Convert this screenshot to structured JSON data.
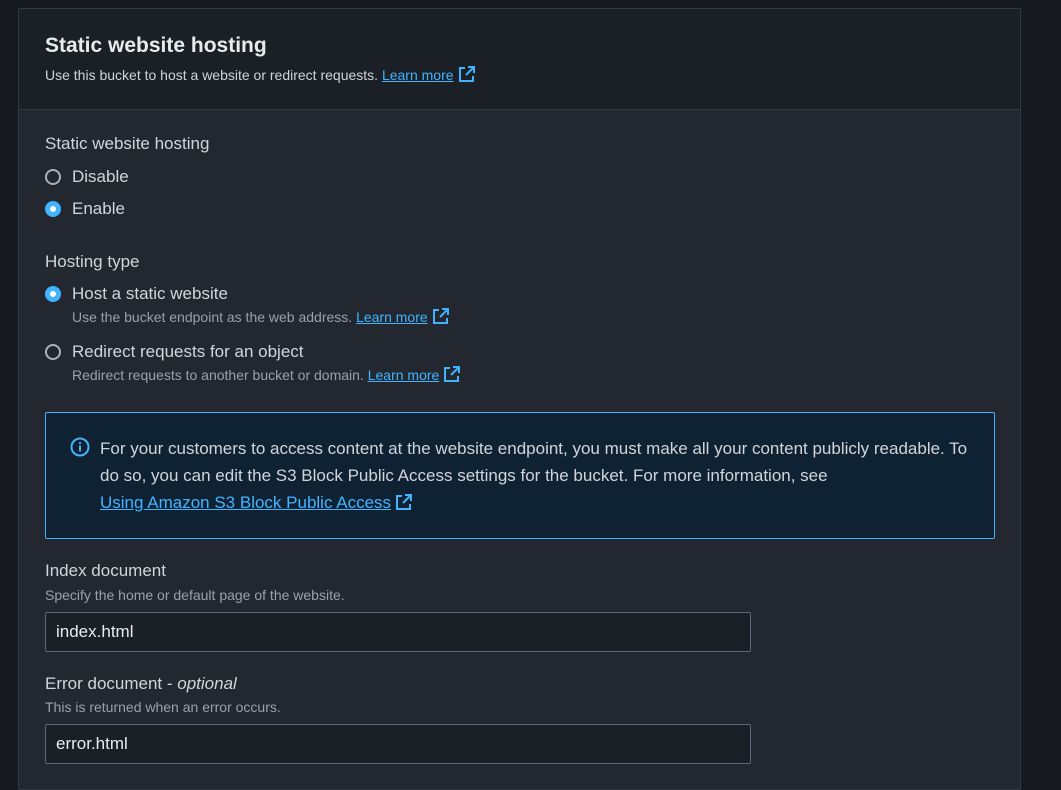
{
  "header": {
    "title": "Static website hosting",
    "description": "Use this bucket to host a website or redirect requests.",
    "learn_more": "Learn more"
  },
  "hosting_toggle": {
    "label": "Static website hosting",
    "options": [
      {
        "label": "Disable",
        "checked": false
      },
      {
        "label": "Enable",
        "checked": true
      }
    ]
  },
  "hosting_type": {
    "label": "Hosting type",
    "options": [
      {
        "label": "Host a static website",
        "description": "Use the bucket endpoint as the web address.",
        "learn_more": "Learn more",
        "checked": true
      },
      {
        "label": "Redirect requests for an object",
        "description": "Redirect requests to another bucket or domain.",
        "learn_more": "Learn more",
        "checked": false
      }
    ]
  },
  "info_alert": {
    "text": "For your customers to access content at the website endpoint, you must make all your content publicly readable. To do so, you can edit the S3 Block Public Access settings for the bucket. For more information, see",
    "link": "Using Amazon S3 Block Public Access"
  },
  "index_document": {
    "label": "Index document",
    "description": "Specify the home or default page of the website.",
    "value": "index.html"
  },
  "error_document": {
    "label": "Error document - ",
    "label_optional": "optional",
    "description": "This is returned when an error occurs.",
    "value": "error.html"
  },
  "colors": {
    "accent": "#42b4ff",
    "panel_bg": "#232830",
    "header_bg": "#1b1f26",
    "alert_bg": "#0f2233"
  }
}
